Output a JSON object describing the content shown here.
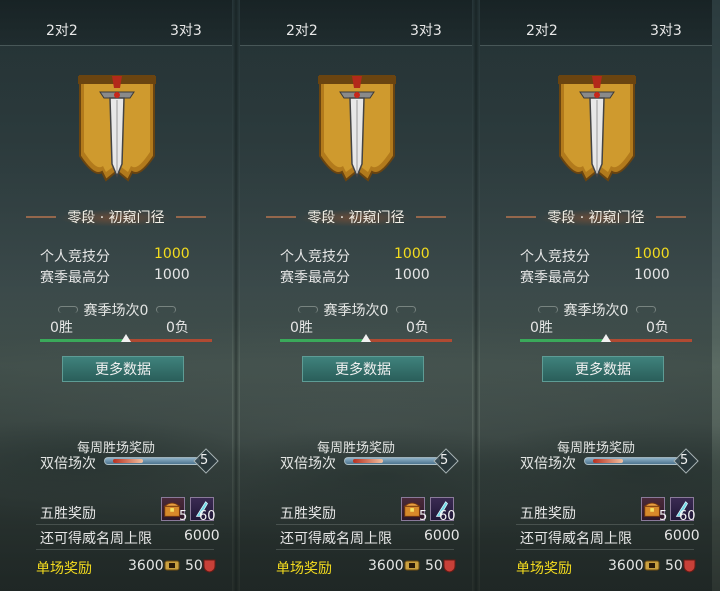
{
  "tabs": [
    "2对2",
    "3对3"
  ],
  "rank_title": "零段 · 初窥门径",
  "stats": {
    "score_label": "个人竞技分",
    "score_value": "1000",
    "best_label": "赛季最高分",
    "best_value": "1000"
  },
  "season": {
    "matches_label": "赛季场次0",
    "wins": "0胜",
    "losses": "0负",
    "win_ratio": 0.5
  },
  "more_button": "更多数据",
  "weekly": {
    "title": "每周胜场奖励",
    "double_label": "双倍场次",
    "double_count": "5"
  },
  "five_win": {
    "label": "五胜奖励",
    "item1_count": "5",
    "item2_count": "60"
  },
  "prestige": {
    "label": "还可得威名周上限",
    "value": "6000"
  },
  "single_reward": {
    "label": "单场奖励",
    "coins": "3600",
    "honor": "50"
  },
  "colors": {
    "highlight_gold": "#f4dc1e",
    "win_green": "#3aa95a",
    "loss_red": "#b04a32",
    "button_teal": "#35706b"
  },
  "icons": [
    "sword-banner-emblem",
    "cloud-ornament-icon",
    "treasure-chest-icon",
    "feather-icon",
    "coin-icon",
    "shield-icon"
  ]
}
